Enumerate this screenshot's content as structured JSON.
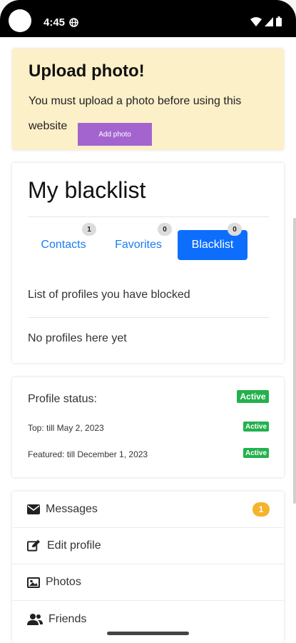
{
  "status_bar": {
    "time": "4:45"
  },
  "upload": {
    "title": "Upload photo!",
    "text": "You must upload a photo before using this website",
    "button_label": "Add photo"
  },
  "blacklist": {
    "title": "My blacklist",
    "tabs": [
      {
        "label": "Contacts",
        "count": "1"
      },
      {
        "label": "Favorites",
        "count": "0"
      },
      {
        "label": "Blacklist",
        "count": "0"
      }
    ],
    "description": "List of profiles you have blocked",
    "empty_text": "No profiles here yet"
  },
  "profile_status": {
    "label": "Profile status:",
    "status": "Active",
    "top": {
      "label": "Top: till May 2, 2023",
      "status": "Active"
    },
    "featured": {
      "label": "Featured: till December 1, 2023",
      "status": "Active"
    }
  },
  "menu": {
    "items": [
      {
        "label": "Messages",
        "icon": "envelope-icon",
        "badge": "1"
      },
      {
        "label": "Edit profile",
        "icon": "edit-icon"
      },
      {
        "label": "Photos",
        "icon": "image-icon"
      },
      {
        "label": "Friends",
        "icon": "users-icon"
      }
    ]
  },
  "colors": {
    "upload_bg": "#fcf0c9",
    "add_photo_btn": "#a364cf",
    "primary": "#0d6efd",
    "active_badge": "#23b14d",
    "message_badge": "#f5b22a"
  }
}
